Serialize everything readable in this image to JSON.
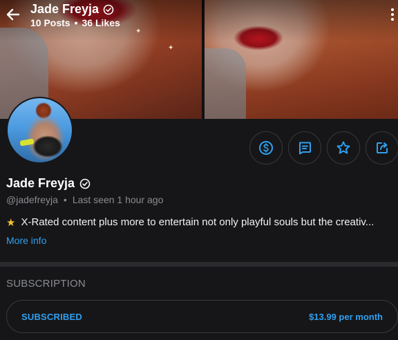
{
  "header": {
    "name": "Jade Freyja",
    "posts": "10 Posts",
    "separator": "•",
    "likes": "36 Likes"
  },
  "profile": {
    "name": "Jade Freyja",
    "handle": "@jadefreyja",
    "separator": "•",
    "last_seen": "Last seen 1 hour ago",
    "bio_icon": "★",
    "bio": "X-Rated content plus more to entertain not only playful souls but the creativ...",
    "more_info": "More info"
  },
  "actions": [
    {
      "icon": "dollar-icon",
      "label": "tip"
    },
    {
      "icon": "message-icon",
      "label": "message"
    },
    {
      "icon": "star-icon",
      "label": "favorite"
    },
    {
      "icon": "share-icon",
      "label": "share"
    }
  ],
  "subscription": {
    "section_title": "SUBSCRIPTION",
    "status": "SUBSCRIBED",
    "price": "$13.99 per month"
  },
  "colors": {
    "accent": "#2fa0f0",
    "background": "#161618",
    "muted": "#8a8c91",
    "star": "#f4c430"
  }
}
